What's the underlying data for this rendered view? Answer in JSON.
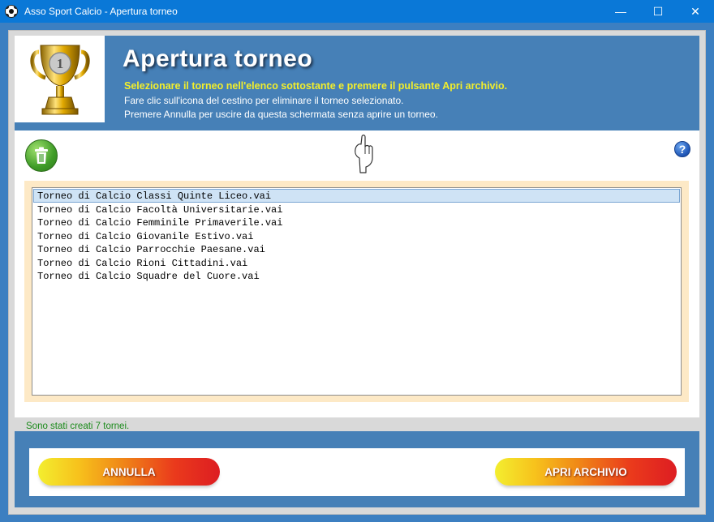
{
  "window": {
    "title": "Asso Sport Calcio - Apertura torneo",
    "minimize": "—",
    "maximize": "☐",
    "close": "✕"
  },
  "header": {
    "title": "Apertura torneo",
    "line1": "Selezionare il torneo nell'elenco sottostante e premere il pulsante Apri archivio.",
    "line2": "Fare clic sull'icona del cestino per eliminare il torneo selezionato.",
    "line3": "Premere Annulla per uscire da questa schermata senza aprire un torneo.",
    "trophy_numeral": "1"
  },
  "toolbar": {
    "help_label": "?"
  },
  "list": {
    "selected_index": 0,
    "items": [
      "Torneo di Calcio Classi Quinte Liceo.vai",
      "Torneo di Calcio Facoltà Universitarie.vai",
      "Torneo di Calcio Femminile Primaverile.vai",
      "Torneo di Calcio Giovanile Estivo.vai",
      "Torneo di Calcio Parrocchie Paesane.vai",
      "Torneo di Calcio Rioni Cittadini.vai",
      "Torneo di Calcio Squadre del Cuore.vai"
    ]
  },
  "status": {
    "text": "Sono stati creati 7 tornei."
  },
  "footer": {
    "cancel_label": "ANNULLA",
    "open_label": "APRI ARCHIVIO"
  },
  "colors": {
    "titlebar": "#0a78d7",
    "frame": "#3c7fc1",
    "header_bg": "#4680b7",
    "header_accent": "#f2ee2b",
    "status_text": "#1a8a1a",
    "list_frame": "#fde9c6"
  }
}
